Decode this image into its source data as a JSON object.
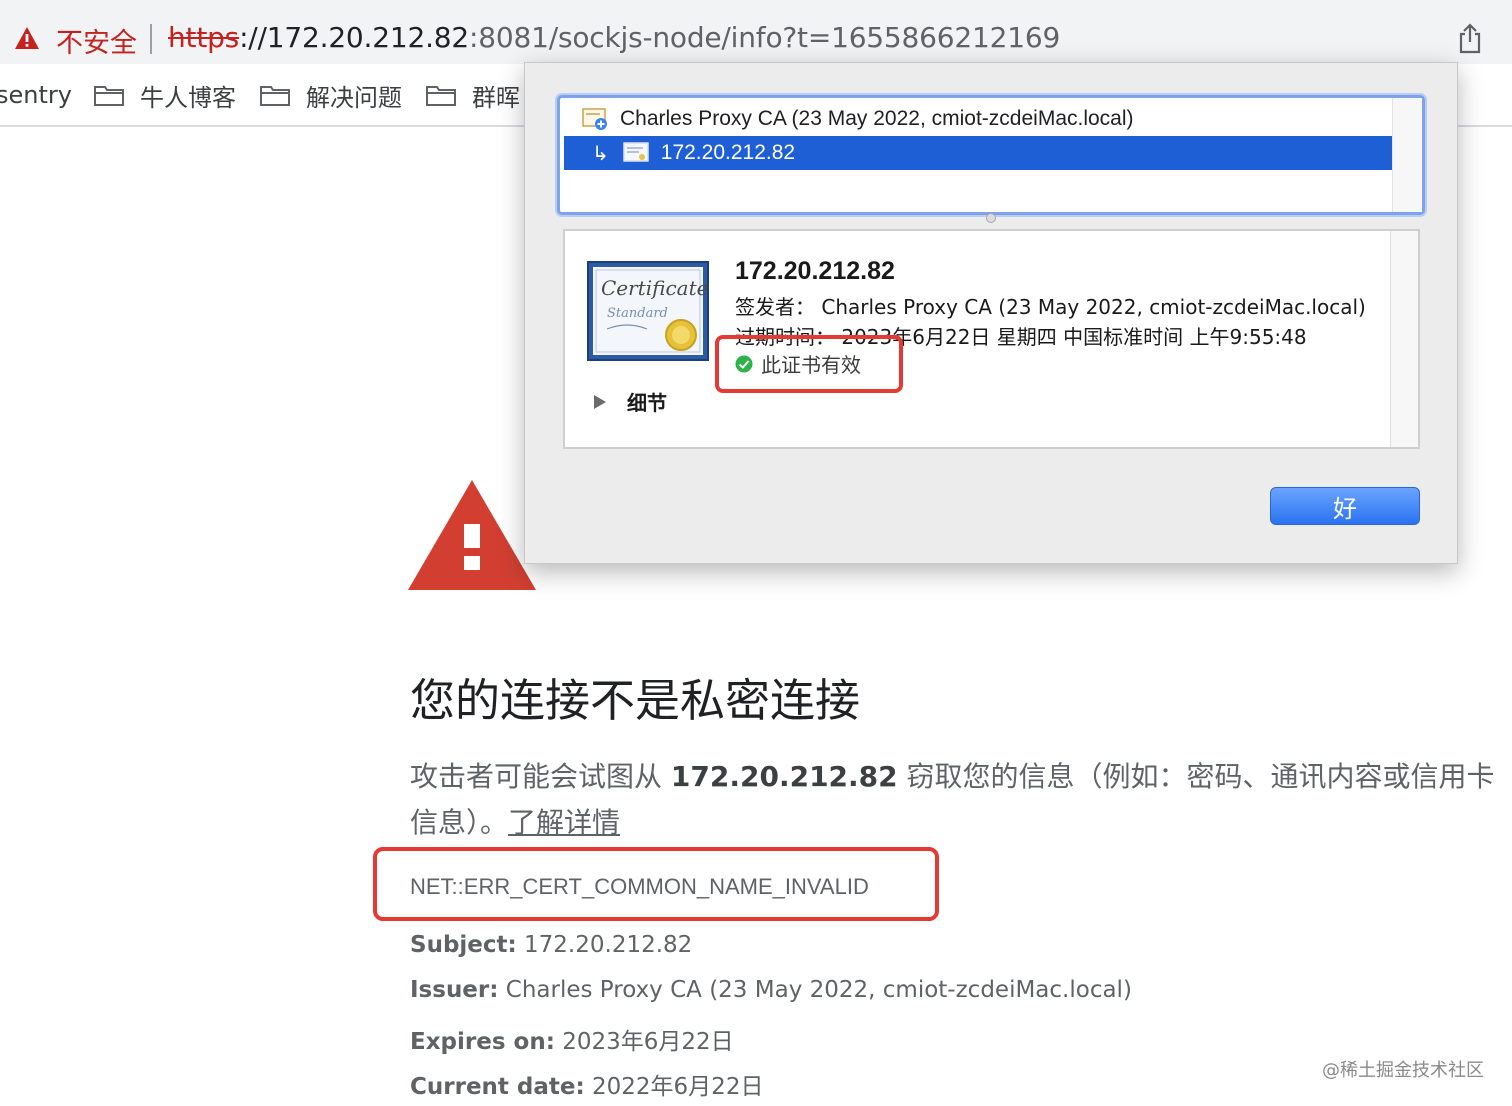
{
  "address_bar": {
    "insecure_label": "不安全",
    "url_scheme": "https",
    "url_rest": "://172.20.212.82",
    "url_port": ":8081/sockjs-node/info?t=1655866212169"
  },
  "bookmarks": [
    {
      "label": "sentry"
    },
    {
      "label": "牛人博客"
    },
    {
      "label": "解决问题"
    },
    {
      "label": "群晖"
    }
  ],
  "error_page": {
    "title": "您的连接不是私密连接",
    "desc_before": "攻击者可能会试图从 ",
    "desc_host": "172.20.212.82",
    "desc_after": " 窃取您的信息（例如：密码、通讯内容或信用卡信息）。",
    "learn_more": "了解详情",
    "error_code": "NET::ERR_CERT_COMMON_NAME_INVALID",
    "subject_label": "Subject:",
    "subject_value": " 172.20.212.82",
    "issuer_label": "Issuer:",
    "issuer_value": " Charles Proxy CA (23 May 2022, cmiot-zcdeiMac.local)",
    "expires_label": "Expires on:",
    "expires_value": " 2023年6月22日",
    "current_label": "Current date:",
    "current_value": " 2022年6月22日"
  },
  "cert_dialog": {
    "tree": [
      {
        "label": "Charles Proxy CA (23 May 2022, cmiot-zcdeiMac.local)"
      },
      {
        "label": "172.20.212.82"
      }
    ],
    "cert_title": "172.20.212.82",
    "issuer_line": "签发者：  Charles Proxy CA (23 May 2022, cmiot-zcdeiMac.local)",
    "expiry_line": "过期时间：  2023年6月22日 星期四 中国标准时间 上午9:55:48",
    "valid_text": "此证书有效",
    "details_label": "细节",
    "ok_label": "好"
  },
  "watermark": "@稀土掘金技术社区",
  "colors": {
    "danger": "#d93025",
    "selection": "#1f5fd6",
    "highlight_box": "#e53935",
    "button": "#2a73f0"
  }
}
